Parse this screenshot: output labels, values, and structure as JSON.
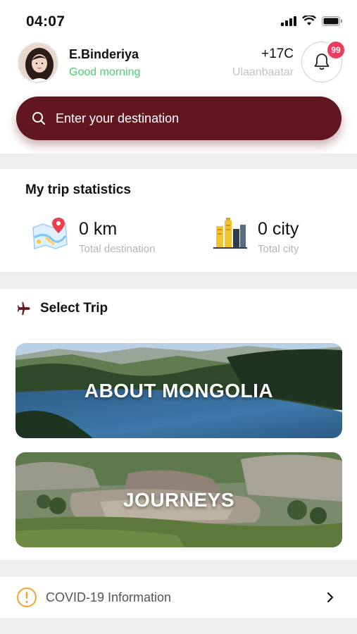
{
  "status_bar": {
    "time": "04:07"
  },
  "user": {
    "name": "E.Binderiya",
    "greeting": "Good morning"
  },
  "weather": {
    "temperature": "+17C",
    "city": "Ulaanbaatar"
  },
  "notifications": {
    "count": "99"
  },
  "search": {
    "placeholder": "Enter your destination"
  },
  "stats": {
    "title": "My trip statistics",
    "items": [
      {
        "value": "0 km",
        "label": "Total destination",
        "icon": "map-pin-icon"
      },
      {
        "value": "0 city",
        "label": "Total city",
        "icon": "city-buildings-icon"
      }
    ]
  },
  "trips": {
    "title": "Select Trip",
    "icon": "airplane-icon",
    "cards": [
      {
        "label": "ABOUT MONGOLIA"
      },
      {
        "label": "JOURNEYS"
      }
    ]
  },
  "covid": {
    "label": "COVID-19 Information"
  },
  "colors": {
    "brand": "#621620",
    "badge": "#ef3b5d",
    "greeting": "#4ccf6d",
    "warning": "#f0a531"
  }
}
